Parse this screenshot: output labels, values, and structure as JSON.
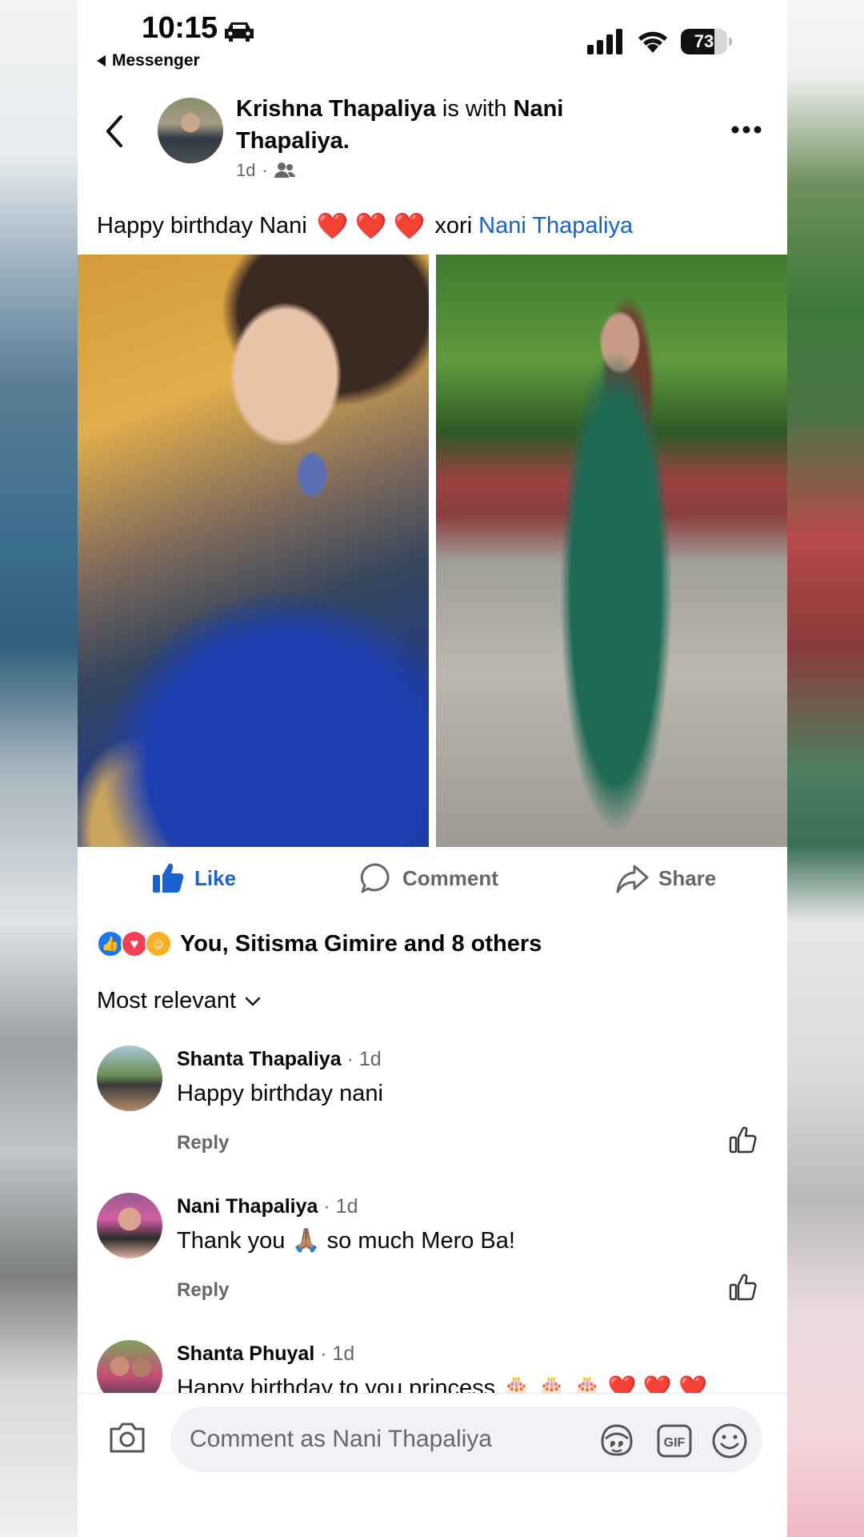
{
  "status_bar": {
    "time": "10:15",
    "back_app": "Messenger",
    "battery": "73",
    "battery_level": 0.73
  },
  "post": {
    "author": "Krishna Thapaliya",
    "with_text": " is with ",
    "tagged": "Nani Thapaliya.",
    "age": "1d",
    "caption_start": "Happy birthday Nani",
    "caption_hearts": [
      "❤️",
      "❤️",
      "❤️"
    ],
    "caption_mid": "xori",
    "caption_mention": "Nani Thapaliya"
  },
  "actions": {
    "like": "Like",
    "comment": "Comment",
    "share": "Share"
  },
  "reactions": {
    "summary": "You, Sitisma Gimire and 8 others"
  },
  "sort": {
    "label": "Most relevant"
  },
  "comments": [
    {
      "name": "Shanta Thapaliya",
      "age": "· 1d",
      "text": "Happy birthday nani",
      "reply": "Reply"
    },
    {
      "name": "Nani Thapaliya",
      "age": "· 1d",
      "text": "Thank you 🙏🏽 so much Mero Ba!",
      "reply": "Reply"
    },
    {
      "name": "Shanta Phuyal",
      "age": "· 1d",
      "text": "Happy birthday to you princess 🎂 🎂 🎂 ❤️ ❤️ ❤️"
    }
  ],
  "composer": {
    "placeholder": "Comment as Nani Thapaliya"
  },
  "colors": {
    "accent_blue": "#1763cf",
    "muted_text": "#65676b",
    "heart_red": "#e41e3f"
  }
}
